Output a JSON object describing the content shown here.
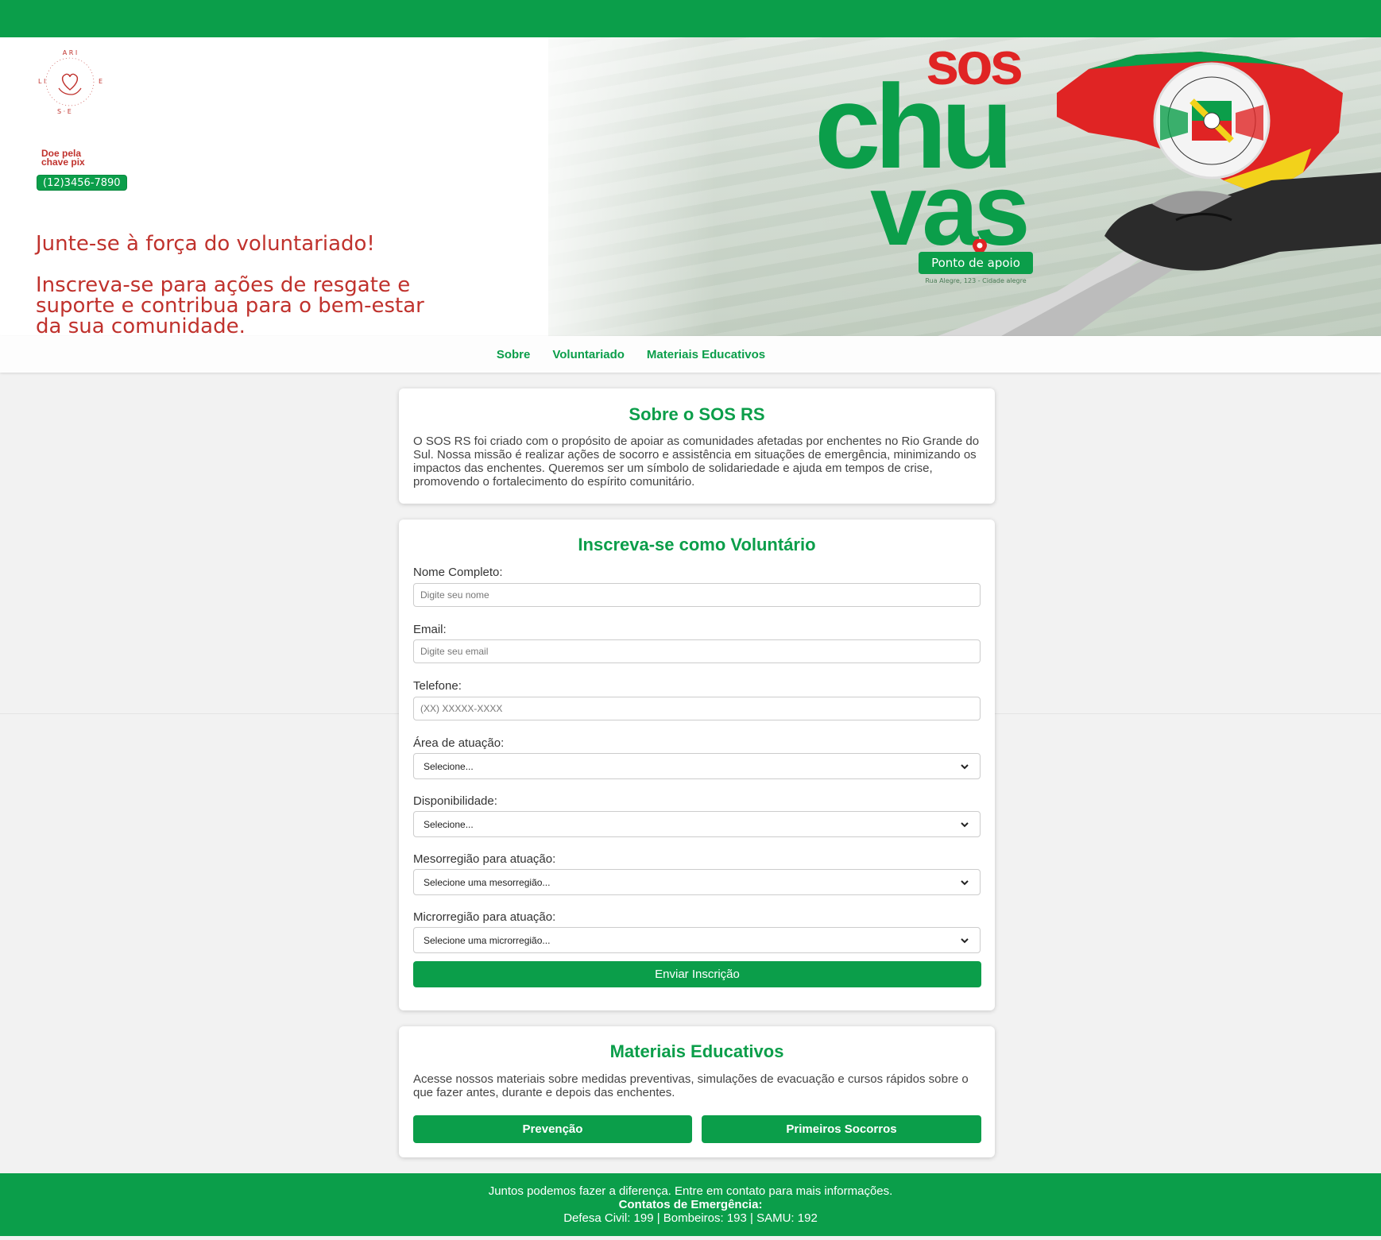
{
  "hero": {
    "logo_text": "SOLIDARIEDADE",
    "pix_label": "Doe pela chave pix",
    "pix_key": "(12)3456-7890",
    "headline": "Junte-se à força do voluntariado!",
    "subtext": "Inscreva-se para ações de resgate e suporte e contribua para o bem-estar da sua comunidade.",
    "campaign_word_1": "sos",
    "campaign_word_2": "chu",
    "campaign_word_3": "vas",
    "support_point_button": "Ponto de apoio",
    "support_point_address": "Rua Alegre, 123 - Cidade alegre"
  },
  "nav": {
    "items": [
      "Sobre",
      "Voluntariado",
      "Materiais Educativos"
    ]
  },
  "about": {
    "title": "Sobre o SOS RS",
    "text": "O SOS RS foi criado com o propósito de apoiar as comunidades afetadas por enchentes no Rio Grande do Sul. Nossa missão é realizar ações de socorro e assistência em situações de emergência, minimizando os impactos das enchentes. Queremos ser um símbolo de solidariedade e ajuda em tempos de crise, promovendo o fortalecimento do espírito comunitário."
  },
  "form": {
    "title": "Inscreva-se como Voluntário",
    "name_label": "Nome Completo:",
    "name_placeholder": "Digite seu nome",
    "email_label": "Email:",
    "email_placeholder": "Digite seu email",
    "phone_label": "Telefone:",
    "phone_placeholder": "(XX) XXXXX-XXXX",
    "area_label": "Área de atuação:",
    "area_value": "Selecione...",
    "availability_label": "Disponibilidade:",
    "availability_value": "Selecione...",
    "mesoregion_label": "Mesorregião para atuação:",
    "mesoregion_value": "Selecione uma mesorregião...",
    "microregion_label": "Microrregião para atuação:",
    "microregion_value": "Selecione uma microrregião...",
    "submit_label": "Enviar Inscrição"
  },
  "materials": {
    "title": "Materiais Educativos",
    "text": "Acesse nossos materiais sobre medidas preventivas, simulações de evacuação e cursos rápidos sobre o que fazer antes, durante e depois das enchentes.",
    "prevention_label": "Prevenção",
    "first_aid_label": "Primeiros Socorros"
  },
  "footer": {
    "line1": "Juntos podemos fazer a diferença. Entre em contato para mais informações.",
    "contacts_title": "Contatos de Emergência:",
    "contacts": "Defesa Civil: 199 | Bombeiros: 193 | SAMU: 192"
  },
  "colors": {
    "brand_green": "#0b9e4a",
    "accent_red": "#c0322d"
  }
}
